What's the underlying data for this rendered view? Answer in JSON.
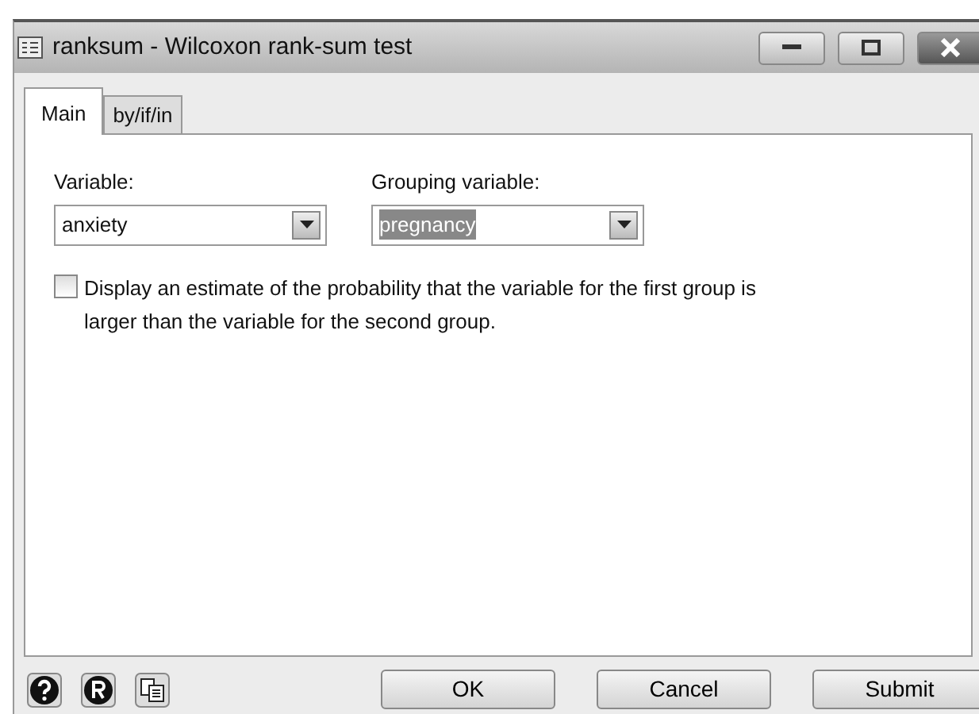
{
  "window": {
    "title": "ranksum - Wilcoxon rank-sum test"
  },
  "tabs": [
    {
      "label": "Main",
      "selected": true
    },
    {
      "label": "by/if/in",
      "selected": false
    }
  ],
  "fields": [
    {
      "label": "Variable:",
      "value": "anxiety",
      "highlighted": false
    },
    {
      "label": "Grouping variable:",
      "value": "pregnancy",
      "highlighted": true
    }
  ],
  "option": {
    "label": "Display an estimate of the probability that the variable for the first group is larger than the variable for the second group.",
    "checked": false
  },
  "buttons": [
    "OK",
    "Cancel",
    "Submit"
  ]
}
